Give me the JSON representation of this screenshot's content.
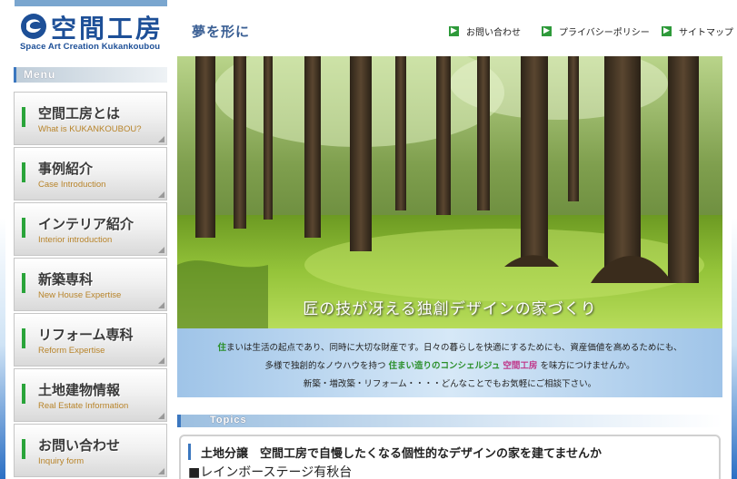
{
  "header": {
    "logo_name": "空間工房",
    "logo_sub": "Space Art Creation Kukankoubou",
    "tagline": "夢を形に",
    "links": [
      {
        "label": "お問い合わせ"
      },
      {
        "label": "プライバシーポリシー"
      },
      {
        "label": "サイトマップ"
      }
    ]
  },
  "sidebar": {
    "menu_label": "Menu",
    "items": [
      {
        "jp": "空間工房とは",
        "en": "What is KUKANKOUBOU?"
      },
      {
        "jp": "事例紹介",
        "en": "Case Introduction"
      },
      {
        "jp": "インテリア紹介",
        "en": "Interior  introduction"
      },
      {
        "jp": "新築専科",
        "en": "New House Expertise"
      },
      {
        "jp": "リフォーム専科",
        "en": "Reform Expertise"
      },
      {
        "jp": "土地建物情報",
        "en": "Real Estate Information"
      },
      {
        "jp": "お問い合わせ",
        "en": "Inquiry form"
      }
    ]
  },
  "hero": {
    "caption": "匠の技が冴える独創デザインの家づくり"
  },
  "intro": {
    "line1_hl": "住",
    "line1": "まいは生活の起点であり、同時に大切な財産です。日々の暮らしを快適にするためにも、資産価値を高めるためにも、",
    "line2_a": "多様で独創的なノウハウを持つ",
    "line2_hl": "住まい造りのコンシェルジュ",
    "line2_hl2": "空間工房",
    "line2_b": "を味方につけませんか。",
    "line3": "新築・増改築・リフォーム・・・・どんなことでもお気軽にご相談下さい。"
  },
  "topics": {
    "label": "Topics",
    "title": "土地分譲　空間工房で自慢したくなる個性的なデザインの家を建てませんか",
    "sub": "■レインボーステージ有秋台"
  },
  "colors": {
    "brand_blue": "#1d4f97",
    "accent_green": "#2aa43a"
  }
}
